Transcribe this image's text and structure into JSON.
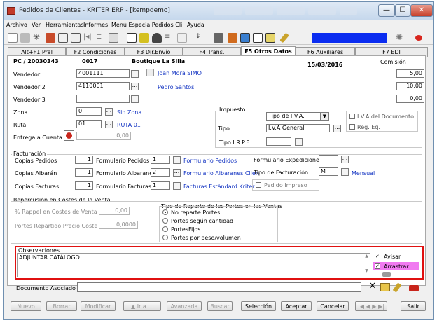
{
  "window": {
    "title": "Pedidos de Clientes - KRITER ERP - [kempdemo]",
    "minimize": "—",
    "maximize": "☐",
    "close": "✕"
  },
  "menu": [
    "Archivo",
    "Ver",
    "Herramientas",
    "Informes",
    "Menú Especia Pedidos Cli",
    "Ayuda"
  ],
  "tabs": [
    {
      "label": "Alt+F1 Pral"
    },
    {
      "label": "F2 Condiciones"
    },
    {
      "label": "F3 Dir.Envío"
    },
    {
      "label": "F4 Trans."
    },
    {
      "label": "F5 Otros Datos"
    },
    {
      "label": "F6 Auxiliares"
    },
    {
      "label": "F7 EDI"
    }
  ],
  "header": {
    "order": "PC / 20030343",
    "client_code": "0017",
    "client_name": "Boutique La Silla",
    "date": "15/03/2016",
    "comision_label": "Comisión"
  },
  "vendedores": {
    "v1_label": "Vendedor",
    "v1_code": "4001111",
    "v1_name": "Joan Mora SIMO",
    "v1_com": "5,00",
    "v2_label": "Vendedor 2",
    "v2_code": "4110001",
    "v2_name": "Pedro Santos",
    "v2_com": "10,00",
    "v3_label": "Vendedor 3",
    "v3_code": "",
    "v3_com": "0,00"
  },
  "zona": {
    "label": "Zona",
    "code": "0",
    "name": "Sin Zona"
  },
  "ruta": {
    "label": "Ruta",
    "code": "01",
    "name": "RUTA 01"
  },
  "entrega": {
    "label": "Entrega a Cuenta",
    "value": "0,00"
  },
  "impuesto": {
    "group_label": "Impuesto",
    "select_value": "Tipo de I.V.A.",
    "tipo_label": "Tipo",
    "tipo_value": "I.V.A General",
    "iva_doc_label": "I.V.A del Documento",
    "reg_eq_label": "Reg. Eq.",
    "irpf_label": "Tipo I.R.P.F",
    "irpf_value": ""
  },
  "facturacion": {
    "group_label": "Facturación",
    "copias_pedidos_label": "Copias Pedidos",
    "copias_pedidos": "1",
    "form_pedidos_label": "Formulario Pedidos",
    "form_pedidos_code": "1",
    "form_pedidos_name": "Formulario Pedidos",
    "form_exped_label": "Formulario Expediciones",
    "form_exped_code": "",
    "copias_albaran_label": "Copias Albarán",
    "copias_albaran": "1",
    "form_albaranes_label": "Formulario Albaranes",
    "form_albaranes_code": "2",
    "form_albaranes_name": "Formulario Albaranes Clien",
    "tipo_fact_label": "Tipo de Facturación",
    "tipo_fact_code": "M",
    "tipo_fact_name": "Mensual",
    "copias_facturas_label": "Copias Facturas",
    "copias_facturas": "1",
    "form_facturas_label": "Formulario Facturas",
    "form_facturas_code": "1",
    "form_facturas_name": "Facturas Estándard Kriter I",
    "pedido_impreso_label": "Pedido Impreso"
  },
  "portes": {
    "group_label": "Repercusión en Costes de la Venta",
    "rappel_label": "% Rappel en Costes de Venta",
    "rappel_value": "0,00",
    "repartido_label": "Portes Repartido Precio Coste",
    "repartido_value": "0,0000",
    "reparto_label": "Tipo de Reparto de los Portes en las Ventas",
    "options": [
      "No reparte Portes",
      "Portes según cantidad",
      "PortesFijos",
      "Portes por peso/volumen"
    ]
  },
  "observaciones": {
    "label": "Observaciones",
    "text": "ADJUNTAR CATÁLOGO",
    "avisar_label": "Avisar",
    "arrastrar_label": "Arrastrar"
  },
  "documento": {
    "label": "Documento Asociado",
    "value": ""
  },
  "buttons": {
    "nuevo": "Nuevo",
    "borrar": "Borrar",
    "modificar": "Modificar",
    "ir_a": "▲ Ir a ...",
    "avanzada": "Avanzada",
    "buscar": "Buscar",
    "seleccion": "Selección",
    "aceptar": "Aceptar",
    "cancelar": "Cancelar",
    "salir": "Salir"
  },
  "colors": {
    "highlight_border": "#e01010",
    "link": "#1233c2",
    "accent_blue": "#0a2cf0"
  }
}
